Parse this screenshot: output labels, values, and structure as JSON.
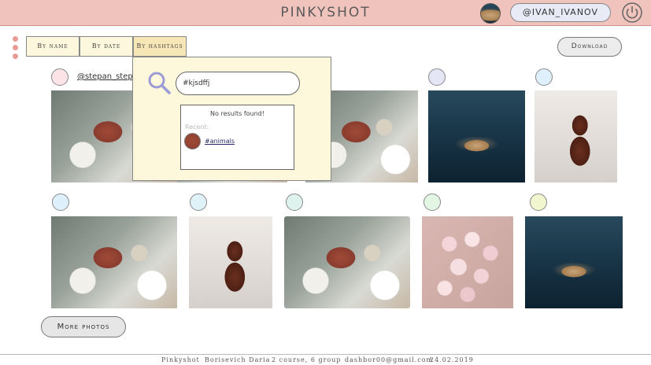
{
  "header": {
    "title": "PINKYSHOT",
    "username": "@IVAN_IVANOV",
    "colors": {
      "bar": "#f0c3bd",
      "pill": "#e8eaf6"
    }
  },
  "tabs": [
    {
      "label": "By name",
      "active": false
    },
    {
      "label": "By date",
      "active": false
    },
    {
      "label": "By hashtags",
      "active": true
    }
  ],
  "toolbar": {
    "download_label": "Download"
  },
  "feed": {
    "first_username": "@stepan_stepan",
    "row1": [
      {
        "image": "turtle",
        "circle": "#fbe3e6"
      },
      {
        "image": "turtle",
        "circle": "#fbe3e6"
      },
      {
        "image": "turtle",
        "circle": "#e6f0f7"
      },
      {
        "image": "octopus",
        "circle": "#e4e6f5"
      },
      {
        "image": "violin",
        "circle": "#def0fb"
      }
    ],
    "row2": [
      {
        "image": "turtle",
        "circle": "#def0fb"
      },
      {
        "image": "violin",
        "circle": "#def2f8"
      },
      {
        "image": "turtle",
        "circle": "#def3ee"
      },
      {
        "image": "roses",
        "circle": "#e3f5e3"
      },
      {
        "image": "octopus",
        "circle": "#f2f6cf"
      }
    ]
  },
  "more_button": "More photos",
  "search_popup": {
    "query": "#kjsdffj",
    "no_results": "No results found!",
    "recent_label": "Recent:",
    "recent_tag": "#animals"
  },
  "footer": {
    "app": "Pinkyshot",
    "author": "Borisevich Daria",
    "course": "2 course,  6 group",
    "email": "dashbor00@gmail.com",
    "date": "24.02.2019"
  }
}
